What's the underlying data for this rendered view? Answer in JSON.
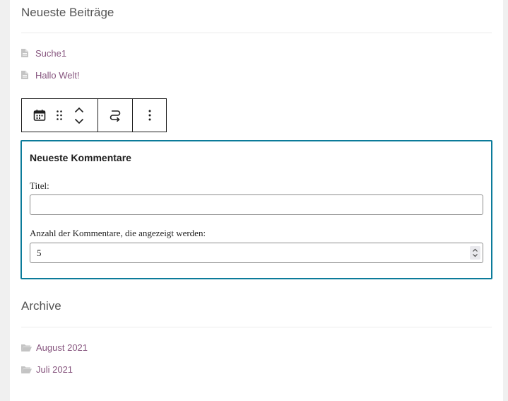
{
  "recent_posts": {
    "title": "Neueste Beiträge",
    "items": [
      {
        "label": "Suche1"
      },
      {
        "label": "Hallo Welt!"
      }
    ]
  },
  "toolbar": {
    "buttons": [
      {
        "icon": "calendar-icon"
      },
      {
        "icon": "drag-handle-icon"
      },
      {
        "icon": "move-up-icon"
      },
      {
        "icon": "move-down-icon"
      },
      {
        "icon": "transform-icon"
      },
      {
        "icon": "more-options-icon"
      }
    ]
  },
  "recent_comments": {
    "title": "Neueste Kommentare",
    "title_label": "Titel:",
    "title_value": "",
    "count_label": "Anzahl der Kommentare, die angezeigt werden:",
    "count_value": "5"
  },
  "archive": {
    "title": "Archive",
    "items": [
      {
        "label": "August 2021"
      },
      {
        "label": "Juli 2021"
      }
    ]
  },
  "colors": {
    "link": "#87567f",
    "block_border": "#0b7b9a",
    "background": "#f0f0f0"
  }
}
